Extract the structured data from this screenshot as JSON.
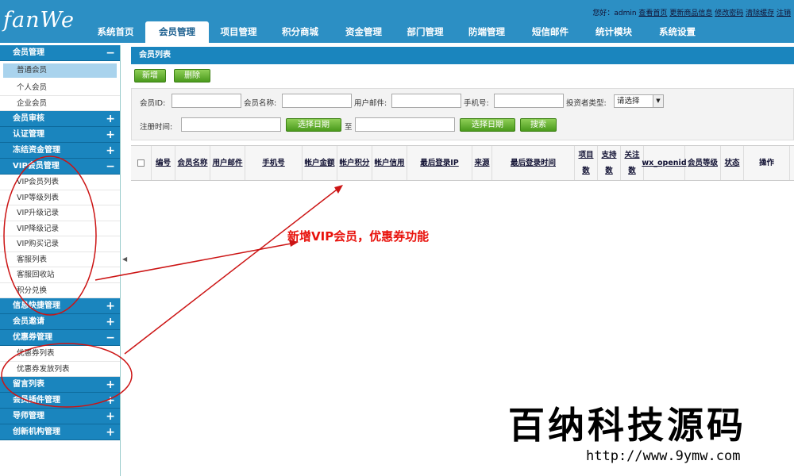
{
  "brand": {
    "logo": "fanWe"
  },
  "topinfo": {
    "prefix": "您好：admin",
    "links": [
      "查看首页",
      "更新商品信息",
      "修改密码",
      "清除缓存",
      "注销"
    ]
  },
  "nav": [
    {
      "label": "系统首页",
      "active": false
    },
    {
      "label": "会员管理",
      "active": true
    },
    {
      "label": "项目管理",
      "active": false
    },
    {
      "label": "积分商城",
      "active": false
    },
    {
      "label": "资金管理",
      "active": false
    },
    {
      "label": "部门管理",
      "active": false
    },
    {
      "label": "防端管理",
      "active": false
    },
    {
      "label": "短信邮件",
      "active": false
    },
    {
      "label": "统计模块",
      "active": false
    },
    {
      "label": "系统设置",
      "active": false
    }
  ],
  "sidebar": [
    {
      "title": "会员管理",
      "open": true,
      "items": [
        {
          "label": "普通会员",
          "active": true
        },
        {
          "label": "个人会员"
        },
        {
          "label": "企业会员"
        }
      ]
    },
    {
      "title": "会员审核",
      "open": false,
      "items": []
    },
    {
      "title": "认证管理",
      "open": false,
      "items": []
    },
    {
      "title": "冻结资金管理",
      "open": false,
      "items": []
    },
    {
      "title": "VIP会员管理",
      "open": true,
      "items": [
        {
          "label": "VIP会员列表"
        },
        {
          "label": "VIP等级列表"
        },
        {
          "label": "VIP升级记录"
        },
        {
          "label": "VIP降级记录"
        },
        {
          "label": "VIP购买记录"
        },
        {
          "label": "客服列表"
        },
        {
          "label": "客服回收站"
        },
        {
          "label": "积分兑换"
        }
      ]
    },
    {
      "title": "信息快捷管理",
      "open": false,
      "items": []
    },
    {
      "title": "会员邀请",
      "open": false,
      "items": []
    },
    {
      "title": "优惠券管理",
      "open": true,
      "items": [
        {
          "label": "优惠券列表"
        },
        {
          "label": "优惠券发放列表"
        }
      ]
    },
    {
      "title": "留言列表",
      "open": false,
      "items": []
    },
    {
      "title": "会员插件管理",
      "open": false,
      "items": []
    },
    {
      "title": "导师管理",
      "open": false,
      "items": []
    },
    {
      "title": "创新机构管理",
      "open": false,
      "items": []
    }
  ],
  "main": {
    "title": "会员列表",
    "buttons": {
      "add": "新增",
      "delete": "删除"
    },
    "filters": {
      "member_id": "会员ID:",
      "member_name": "会员名称:",
      "email": "用户邮件:",
      "mobile": "手机号:",
      "investor_type": "投资者类型:",
      "investor_type_value": "请选择",
      "reg_time": "注册时间:",
      "pick_date": "选择日期",
      "to": "至",
      "search": "搜索"
    },
    "columns": [
      "编号",
      "会员名称",
      "用户邮件",
      "手机号",
      "帐户金额",
      "帐户积分",
      "帐户信用",
      "最后登录IP",
      "来源",
      "最后登录时间",
      "项目数",
      "支持数",
      "关注数",
      "wx_openid",
      "会员等级",
      "状态",
      "操作"
    ]
  },
  "annotation": "新增VIP会员，优惠券功能",
  "watermark": {
    "title": "百纳科技源码",
    "url": "http://www.9ymw.com"
  },
  "colors": {
    "brand": "#2c8fc4",
    "annotation": "#e8120c",
    "button": "#5aa62a"
  }
}
